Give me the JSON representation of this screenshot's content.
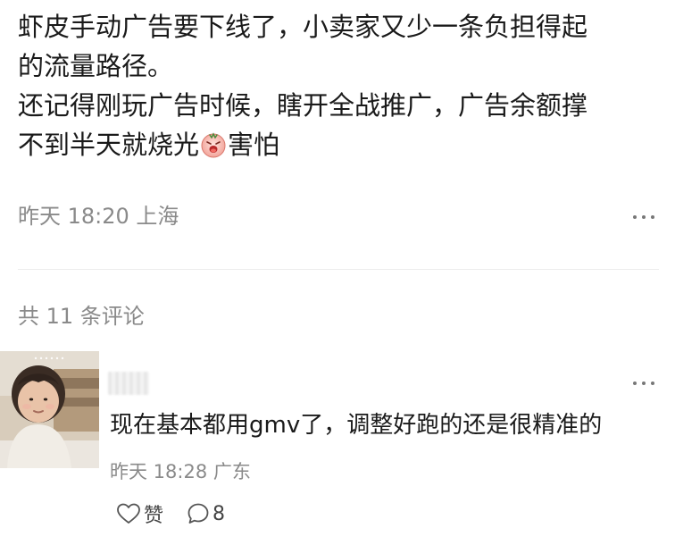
{
  "post": {
    "lines": [
      "虾皮手动广告要下线了，小卖家又少一条负担得起",
      "的流量路径。",
      "还记得刚玩广告时候，瞎开全战推广，广告余额撑"
    ],
    "last_line_before_emoji": "不到半天就烧光",
    "emoji_name": "scared-face-emoji",
    "last_line_after_emoji": "害怕",
    "meta": "昨天 18:20 上海",
    "more_icon": "more-dots-icon"
  },
  "comments_header": "共 11 条评论",
  "comment": {
    "avatar": "child-photo-avatar",
    "username_blurred": true,
    "text": "现在基本都用gmv了，调整好跑的还是很精准的",
    "meta": "昨天 18:28 广东",
    "like_label": "赞",
    "like_icon": "heart-outline-icon",
    "reply_icon": "comment-bubble-icon",
    "reply_count": "8",
    "more_icon": "more-dots-icon"
  }
}
